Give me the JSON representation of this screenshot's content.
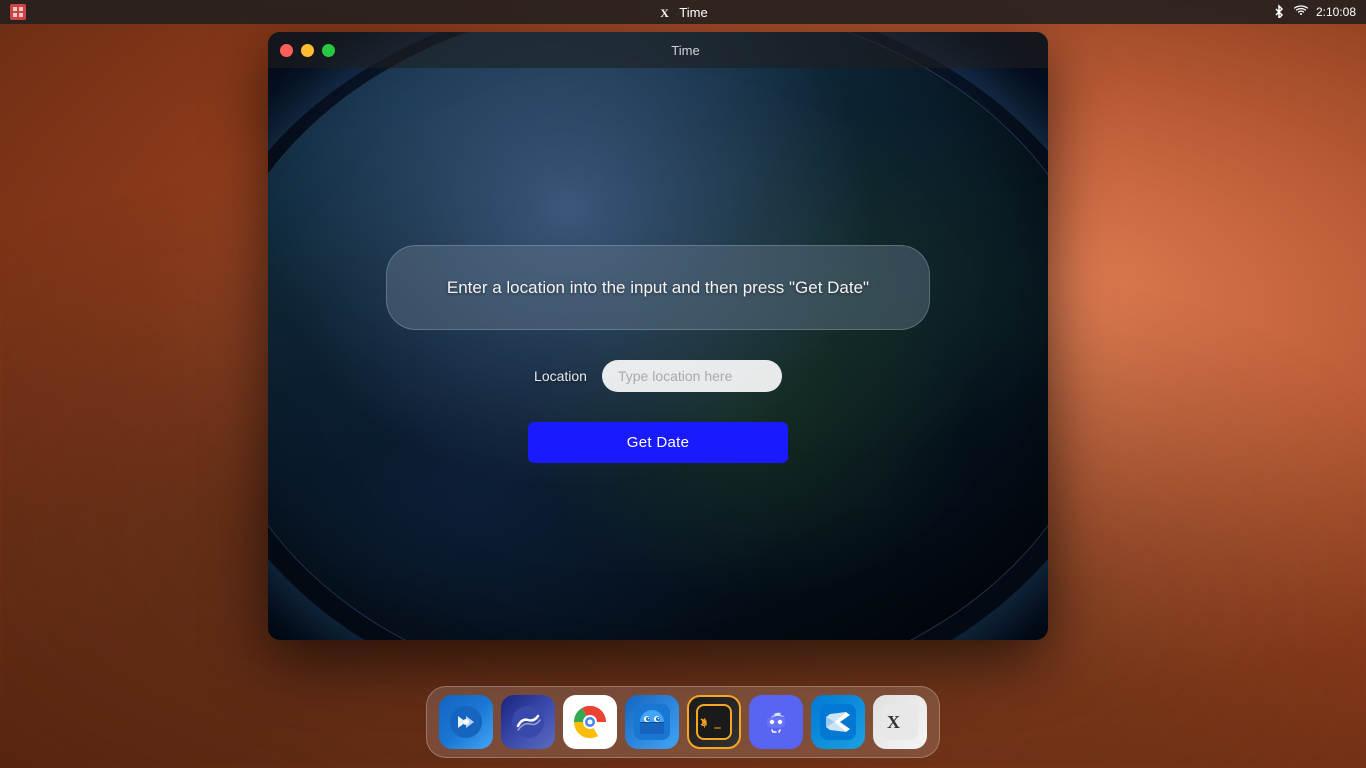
{
  "menubar": {
    "app_icon_label": "X",
    "app_name": "Time",
    "time": "2:10:08",
    "bluetooth": "BT",
    "wifi": "WiFi"
  },
  "window": {
    "title": "Time",
    "controls": {
      "close": "close",
      "minimize": "minimize",
      "maximize": "maximize"
    }
  },
  "app": {
    "info_text": "Enter a location into the input and then press \"Get Date\"",
    "location_label": "Location",
    "location_placeholder": "Type location here",
    "get_date_button": "Get Date"
  },
  "dock": {
    "items": [
      {
        "name": "KDE",
        "type": "kde"
      },
      {
        "name": "Sketch/Wave",
        "type": "sketch"
      },
      {
        "name": "Google Chrome",
        "type": "chrome"
      },
      {
        "name": "Finder",
        "type": "finder"
      },
      {
        "name": "Terminal",
        "type": "terminal"
      },
      {
        "name": "Discord",
        "type": "discord"
      },
      {
        "name": "VS Code",
        "type": "vscode"
      },
      {
        "name": "X11",
        "type": "x11"
      }
    ]
  }
}
